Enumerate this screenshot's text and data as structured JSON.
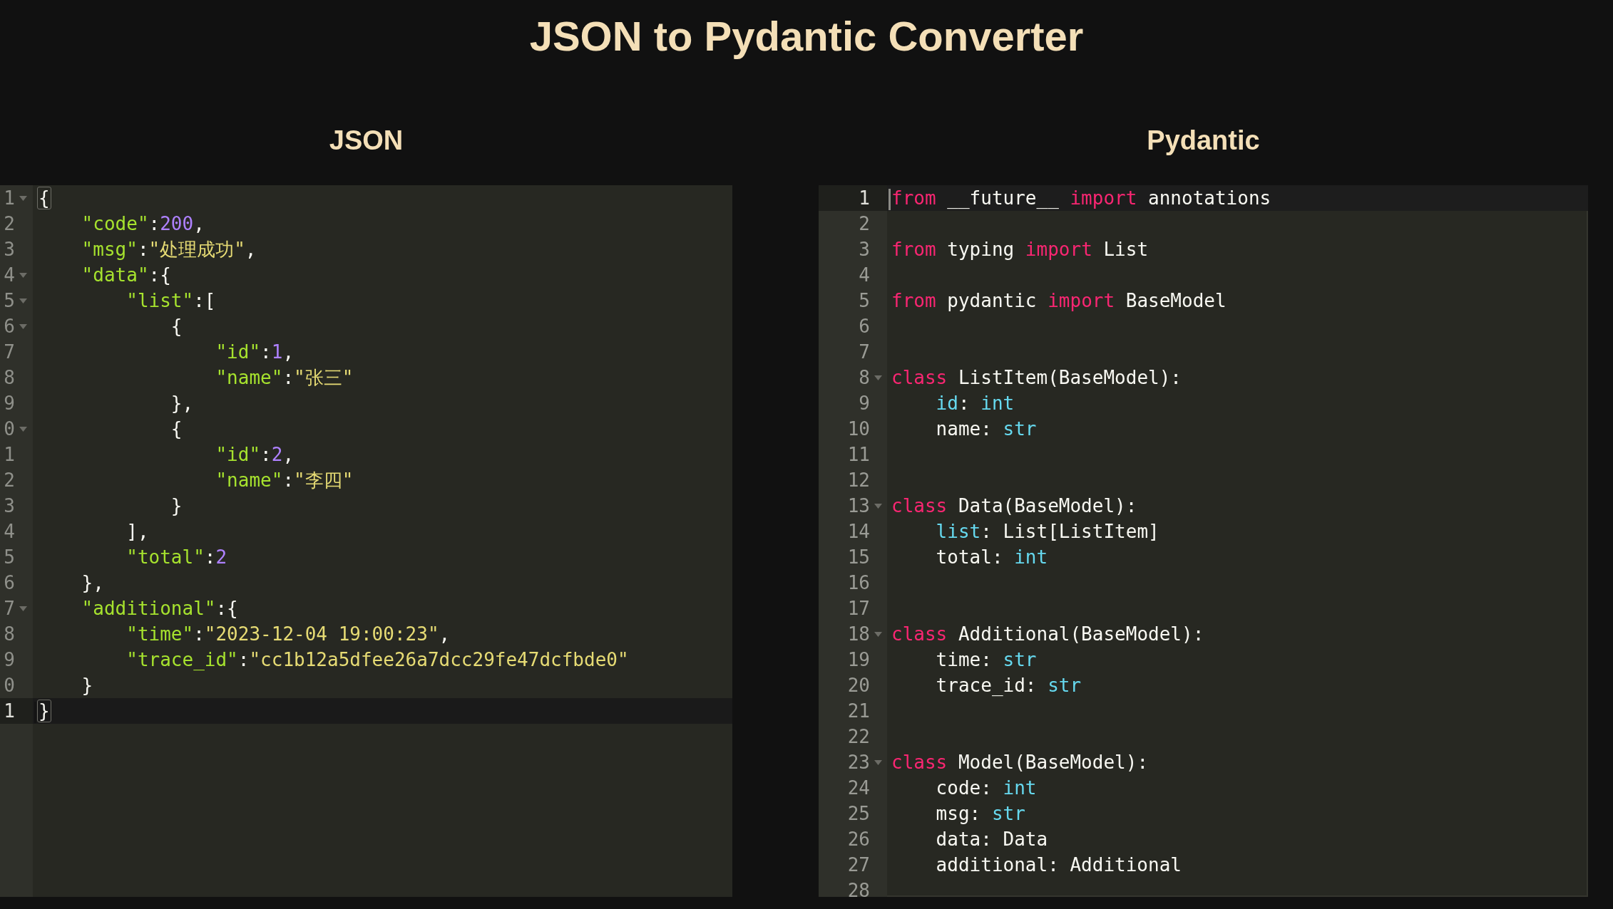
{
  "title": "JSON to Pydantic Converter",
  "panels": [
    {
      "heading": "JSON",
      "focused": false,
      "lines": [
        {
          "number": "1",
          "foldable": true,
          "current": false,
          "tokens": [
            {
              "kind": "bracket",
              "text": "{"
            }
          ]
        },
        {
          "number": "2",
          "foldable": false,
          "current": false,
          "tokens": [
            {
              "kind": "key",
              "text": "    \"code\""
            },
            {
              "kind": "plain",
              "text": ":"
            },
            {
              "kind": "number",
              "text": "200"
            },
            {
              "kind": "plain",
              "text": ","
            }
          ]
        },
        {
          "number": "3",
          "foldable": false,
          "current": false,
          "tokens": [
            {
              "kind": "key",
              "text": "    \"msg\""
            },
            {
              "kind": "plain",
              "text": ":"
            },
            {
              "kind": "string",
              "text": "\"处理成功\""
            },
            {
              "kind": "plain",
              "text": ","
            }
          ]
        },
        {
          "number": "4",
          "foldable": true,
          "current": false,
          "tokens": [
            {
              "kind": "key",
              "text": "    \"data\""
            },
            {
              "kind": "plain",
              "text": ":{"
            }
          ]
        },
        {
          "number": "5",
          "foldable": true,
          "current": false,
          "tokens": [
            {
              "kind": "key",
              "text": "        \"list\""
            },
            {
              "kind": "plain",
              "text": ":["
            }
          ]
        },
        {
          "number": "6",
          "foldable": true,
          "current": false,
          "tokens": [
            {
              "kind": "plain",
              "text": "            {"
            }
          ]
        },
        {
          "number": "7",
          "foldable": false,
          "current": false,
          "tokens": [
            {
              "kind": "key",
              "text": "                \"id\""
            },
            {
              "kind": "plain",
              "text": ":"
            },
            {
              "kind": "number",
              "text": "1"
            },
            {
              "kind": "plain",
              "text": ","
            }
          ]
        },
        {
          "number": "8",
          "foldable": false,
          "current": false,
          "tokens": [
            {
              "kind": "key",
              "text": "                \"name\""
            },
            {
              "kind": "plain",
              "text": ":"
            },
            {
              "kind": "string",
              "text": "\"张三\""
            }
          ]
        },
        {
          "number": "9",
          "foldable": false,
          "current": false,
          "tokens": [
            {
              "kind": "plain",
              "text": "            },"
            }
          ]
        },
        {
          "number": "0",
          "foldable": true,
          "current": false,
          "tokens": [
            {
              "kind": "plain",
              "text": "            {"
            }
          ]
        },
        {
          "number": "1",
          "foldable": false,
          "current": false,
          "tokens": [
            {
              "kind": "key",
              "text": "                \"id\""
            },
            {
              "kind": "plain",
              "text": ":"
            },
            {
              "kind": "number",
              "text": "2"
            },
            {
              "kind": "plain",
              "text": ","
            }
          ]
        },
        {
          "number": "2",
          "foldable": false,
          "current": false,
          "tokens": [
            {
              "kind": "key",
              "text": "                \"name\""
            },
            {
              "kind": "plain",
              "text": ":"
            },
            {
              "kind": "string",
              "text": "\"李四\""
            }
          ]
        },
        {
          "number": "3",
          "foldable": false,
          "current": false,
          "tokens": [
            {
              "kind": "plain",
              "text": "            }"
            }
          ]
        },
        {
          "number": "4",
          "foldable": false,
          "current": false,
          "tokens": [
            {
              "kind": "plain",
              "text": "        ],"
            }
          ]
        },
        {
          "number": "5",
          "foldable": false,
          "current": false,
          "tokens": [
            {
              "kind": "key",
              "text": "        \"total\""
            },
            {
              "kind": "plain",
              "text": ":"
            },
            {
              "kind": "number",
              "text": "2"
            }
          ]
        },
        {
          "number": "6",
          "foldable": false,
          "current": false,
          "tokens": [
            {
              "kind": "plain",
              "text": "    },"
            }
          ]
        },
        {
          "number": "7",
          "foldable": true,
          "current": false,
          "tokens": [
            {
              "kind": "key",
              "text": "    \"additional\""
            },
            {
              "kind": "plain",
              "text": ":{"
            }
          ]
        },
        {
          "number": "8",
          "foldable": false,
          "current": false,
          "tokens": [
            {
              "kind": "key",
              "text": "        \"time\""
            },
            {
              "kind": "plain",
              "text": ":"
            },
            {
              "kind": "string",
              "text": "\"2023-12-04 19:00:23\""
            },
            {
              "kind": "plain",
              "text": ","
            }
          ]
        },
        {
          "number": "9",
          "foldable": false,
          "current": false,
          "tokens": [
            {
              "kind": "key",
              "text": "        \"trace_id\""
            },
            {
              "kind": "plain",
              "text": ":"
            },
            {
              "kind": "string",
              "text": "\"cc1b12a5dfee26a7dcc29fe47dcfbde0\""
            }
          ]
        },
        {
          "number": "0",
          "foldable": false,
          "current": false,
          "tokens": [
            {
              "kind": "plain",
              "text": "    }"
            }
          ]
        },
        {
          "number": "1",
          "foldable": false,
          "current": true,
          "tokens": [
            {
              "kind": "bracket",
              "text": "}"
            }
          ]
        }
      ]
    },
    {
      "heading": "Pydantic",
      "focused": true,
      "lines": [
        {
          "number": "1",
          "foldable": false,
          "current": true,
          "tokens": [
            {
              "kind": "keyword",
              "text": "from"
            },
            {
              "kind": "plain",
              "text": " __future__ "
            },
            {
              "kind": "keyword",
              "text": "import"
            },
            {
              "kind": "plain",
              "text": " annotations"
            }
          ]
        },
        {
          "number": "2",
          "foldable": false,
          "current": false
        },
        {
          "number": "3",
          "foldable": false,
          "current": false,
          "tokens": [
            {
              "kind": "keyword",
              "text": "from"
            },
            {
              "kind": "plain",
              "text": " typing "
            },
            {
              "kind": "keyword",
              "text": "import"
            },
            {
              "kind": "plain",
              "text": " List"
            }
          ]
        },
        {
          "number": "4",
          "foldable": false,
          "current": false
        },
        {
          "number": "5",
          "foldable": false,
          "current": false,
          "tokens": [
            {
              "kind": "keyword",
              "text": "from"
            },
            {
              "kind": "plain",
              "text": " pydantic "
            },
            {
              "kind": "keyword",
              "text": "import"
            },
            {
              "kind": "plain",
              "text": " BaseModel"
            }
          ]
        },
        {
          "number": "6",
          "foldable": false,
          "current": false
        },
        {
          "number": "7",
          "foldable": false,
          "current": false
        },
        {
          "number": "8",
          "foldable": true,
          "current": false,
          "tokens": [
            {
              "kind": "keyword",
              "text": "class"
            },
            {
              "kind": "plain",
              "text": " ListItem(BaseModel):"
            }
          ]
        },
        {
          "number": "9",
          "foldable": false,
          "current": false,
          "tokens": [
            {
              "kind": "builtin",
              "text": "    id"
            },
            {
              "kind": "plain",
              "text": ": "
            },
            {
              "kind": "builtin",
              "text": "int"
            }
          ]
        },
        {
          "number": "10",
          "foldable": false,
          "current": false,
          "tokens": [
            {
              "kind": "plain",
              "text": "    name: "
            },
            {
              "kind": "builtin",
              "text": "str"
            }
          ]
        },
        {
          "number": "11",
          "foldable": false,
          "current": false
        },
        {
          "number": "12",
          "foldable": false,
          "current": false
        },
        {
          "number": "13",
          "foldable": true,
          "current": false,
          "tokens": [
            {
              "kind": "keyword",
              "text": "class"
            },
            {
              "kind": "plain",
              "text": " Data(BaseModel):"
            }
          ]
        },
        {
          "number": "14",
          "foldable": false,
          "current": false,
          "tokens": [
            {
              "kind": "builtin",
              "text": "    list"
            },
            {
              "kind": "plain",
              "text": ": List[ListItem]"
            }
          ]
        },
        {
          "number": "15",
          "foldable": false,
          "current": false,
          "tokens": [
            {
              "kind": "plain",
              "text": "    total: "
            },
            {
              "kind": "builtin",
              "text": "int"
            }
          ]
        },
        {
          "number": "16",
          "foldable": false,
          "current": false
        },
        {
          "number": "17",
          "foldable": false,
          "current": false
        },
        {
          "number": "18",
          "foldable": true,
          "current": false,
          "tokens": [
            {
              "kind": "keyword",
              "text": "class"
            },
            {
              "kind": "plain",
              "text": " Additional(BaseModel):"
            }
          ]
        },
        {
          "number": "19",
          "foldable": false,
          "current": false,
          "tokens": [
            {
              "kind": "plain",
              "text": "    time: "
            },
            {
              "kind": "builtin",
              "text": "str"
            }
          ]
        },
        {
          "number": "20",
          "foldable": false,
          "current": false,
          "tokens": [
            {
              "kind": "plain",
              "text": "    trace_id: "
            },
            {
              "kind": "builtin",
              "text": "str"
            }
          ]
        },
        {
          "number": "21",
          "foldable": false,
          "current": false
        },
        {
          "number": "22",
          "foldable": false,
          "current": false
        },
        {
          "number": "23",
          "foldable": true,
          "current": false,
          "tokens": [
            {
              "kind": "keyword",
              "text": "class"
            },
            {
              "kind": "plain",
              "text": " Model(BaseModel):"
            }
          ]
        },
        {
          "number": "24",
          "foldable": false,
          "current": false,
          "tokens": [
            {
              "kind": "plain",
              "text": "    code: "
            },
            {
              "kind": "builtin",
              "text": "int"
            }
          ]
        },
        {
          "number": "25",
          "foldable": false,
          "current": false,
          "tokens": [
            {
              "kind": "plain",
              "text": "    msg: "
            },
            {
              "kind": "builtin",
              "text": "str"
            }
          ]
        },
        {
          "number": "26",
          "foldable": false,
          "current": false,
          "tokens": [
            {
              "kind": "plain",
              "text": "    data: Data"
            }
          ]
        },
        {
          "number": "27",
          "foldable": false,
          "current": false,
          "tokens": [
            {
              "kind": "plain",
              "text": "    additional: Additional"
            }
          ]
        },
        {
          "number": "28",
          "foldable": false,
          "current": false
        }
      ]
    }
  ]
}
